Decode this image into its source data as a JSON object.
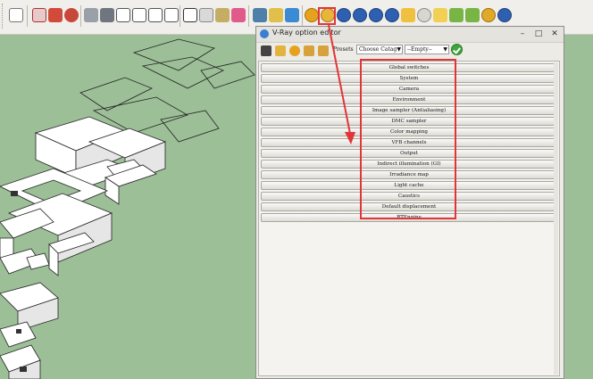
{
  "toolbar": {
    "icons": [
      "select-icon",
      "eraser-icon",
      "paint-bucket-icon",
      "orbit-icon",
      "building-icon",
      "house-icon",
      "cursor-icon",
      "component-icon",
      "scissors-icon",
      "layers-icon",
      "push-pull-icon",
      "download-icon",
      "vray-material-icon",
      "vray-options-icon",
      "vray-render-icon",
      "vray-rt-icon",
      "vray-batch-icon",
      "vray-frame-icon",
      "vray-light-icon",
      "vray-sphere-icon",
      "vray-dome-icon",
      "vray-plane-icon",
      "vray-mesh-icon",
      "vray-proxy-icon",
      "vray-help-icon"
    ]
  },
  "dialog": {
    "title": "V-Ray option editor",
    "presets_label": "Presets",
    "preset_category": "Choose Catag",
    "preset_value": "--Empty--",
    "rollouts": [
      "Global switches",
      "System",
      "Camera",
      "Environment",
      "Image sampler (Antialiasing)",
      "DMC sampler",
      "Color mapping",
      "VFB channels",
      "Output",
      "Indirect illumination (GI)",
      "Irradiance map",
      "Light cache",
      "Caustics",
      "Default displacement",
      "RTEngine"
    ]
  },
  "colors": {
    "highlight": "#e2353a",
    "ground": "#9cbf97",
    "apply": "#3ea63a"
  }
}
